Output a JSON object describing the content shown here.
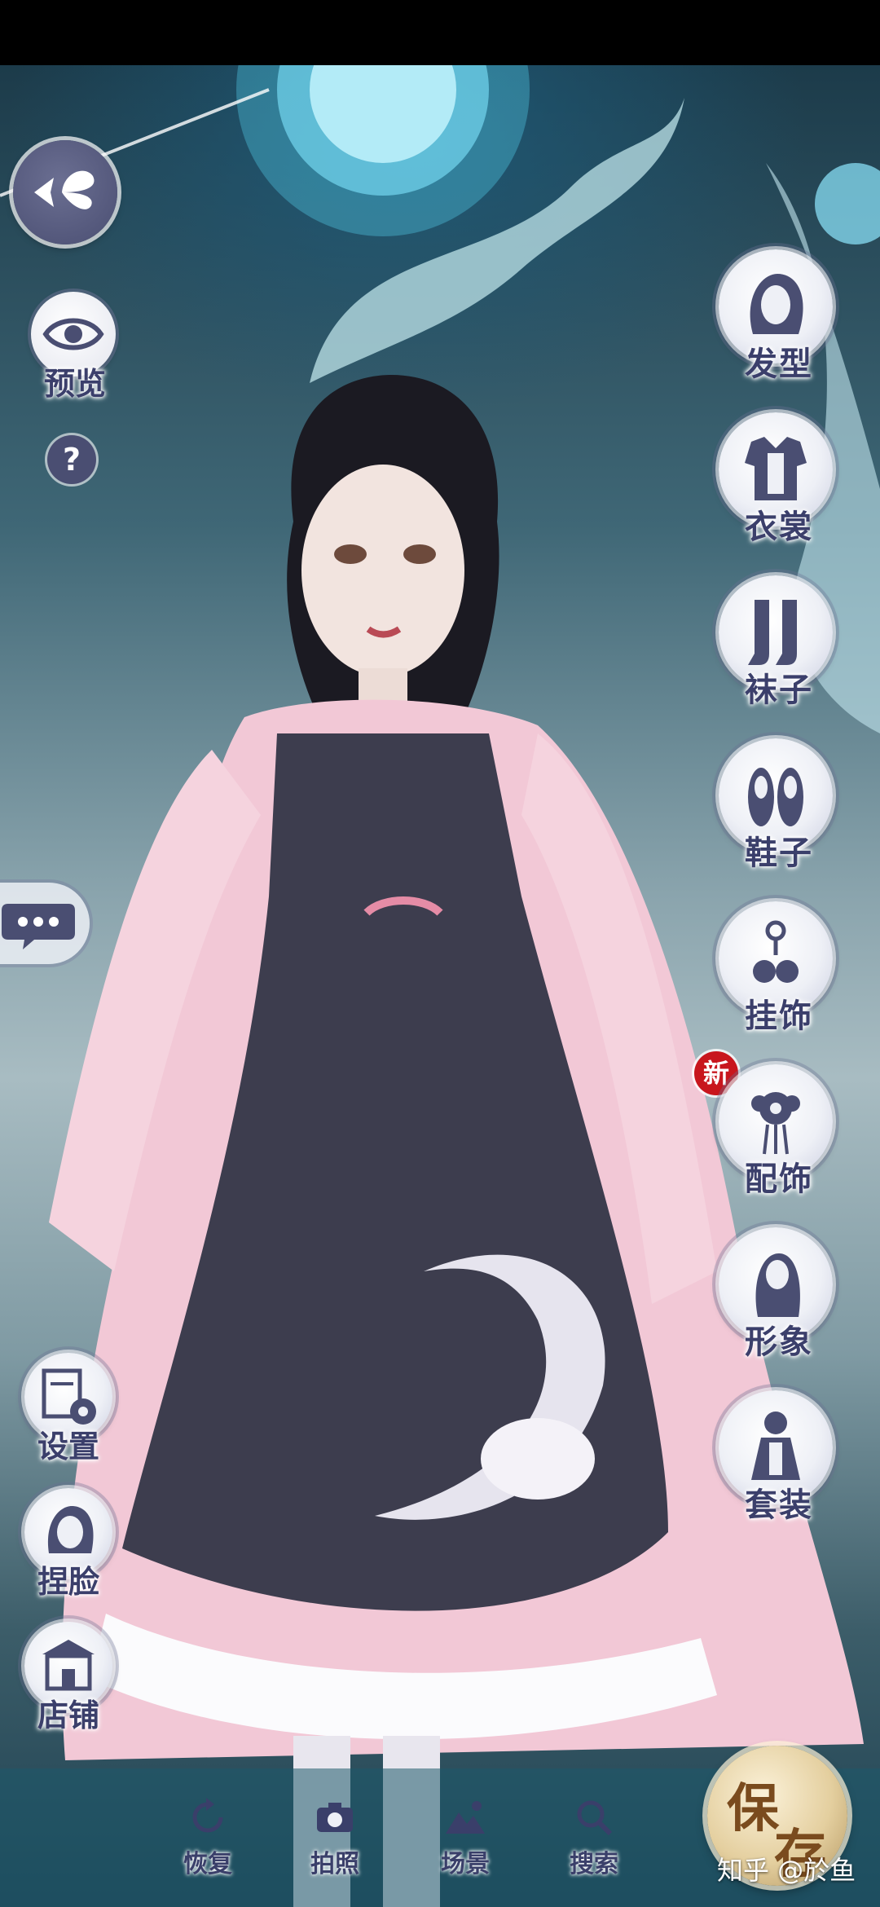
{
  "left_panel": {
    "preview_label": "预览",
    "help_label": "?",
    "settings_label": "设置",
    "face_label": "捏脸",
    "shop_label": "店铺"
  },
  "right_menu": [
    {
      "name": "hair",
      "label": "发型"
    },
    {
      "name": "clothing",
      "label": "衣裳"
    },
    {
      "name": "socks",
      "label": "袜子"
    },
    {
      "name": "shoes",
      "label": "鞋子"
    },
    {
      "name": "pendant",
      "label": "挂饰"
    },
    {
      "name": "accessory",
      "label": "配饰"
    },
    {
      "name": "image",
      "label": "形象"
    },
    {
      "name": "outfit",
      "label": "套装"
    }
  ],
  "new_badge": "新",
  "bottom_nav": [
    {
      "label": "恢复"
    },
    {
      "label": "拍照"
    },
    {
      "label": "场景"
    },
    {
      "label": "搜索"
    }
  ],
  "save_button": {
    "char1": "保",
    "char2": "存"
  },
  "watermark": "知乎 @於鱼",
  "colors": {
    "button_text": "#3b3f6b",
    "save_gold": "#e4cf9f",
    "badge_red": "#c8161d"
  }
}
